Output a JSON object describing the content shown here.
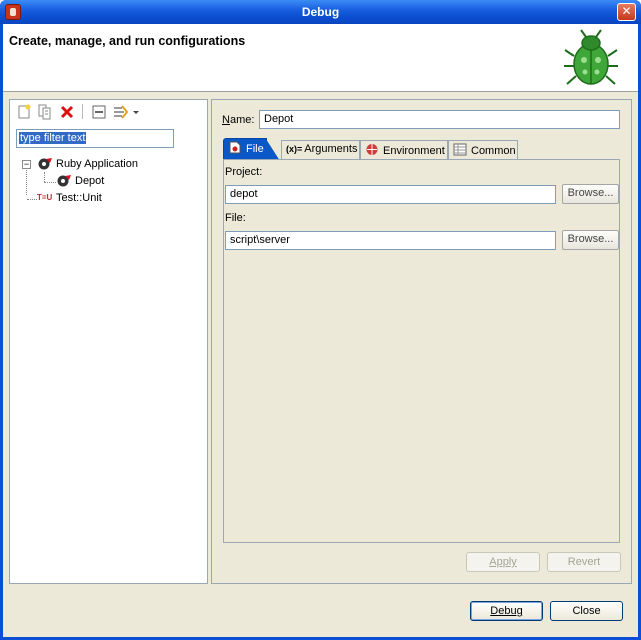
{
  "window": {
    "title": "Debug"
  },
  "banner": {
    "title": "Create, manage, and run configurations",
    "icon": "bug-icon"
  },
  "left_panel": {
    "toolbar": [
      {
        "name": "new-launch-config-icon"
      },
      {
        "name": "duplicate-config-icon"
      },
      {
        "name": "delete-config-icon"
      },
      {
        "name": "collapse-all-icon"
      },
      {
        "name": "filter-configs-icon"
      },
      {
        "name": "view-menu-dropdown-icon"
      }
    ],
    "filter": {
      "value": "type filter text"
    },
    "tree": {
      "expander": "−",
      "items": [
        {
          "label": "Ruby Application",
          "icon": "ruby-app-icon"
        },
        {
          "label": "Depot",
          "icon": "ruby-config-icon"
        },
        {
          "label": "Test::Unit",
          "icon": "testunit-icon",
          "icon_text": "T=U"
        }
      ]
    }
  },
  "right_panel": {
    "name_label_underline": "N",
    "name_label_rest": "ame:",
    "name_value": "Depot",
    "tabs": [
      {
        "label": "File",
        "icon": "file-tab-icon",
        "active": true
      },
      {
        "label": "Arguments",
        "icon": "arguments-tab-icon",
        "icon_text": "(x)="
      },
      {
        "label": "Environment",
        "icon": "environment-tab-icon"
      },
      {
        "label": "Common",
        "icon": "common-tab-icon"
      }
    ],
    "project": {
      "label": "Project:",
      "value": "depot",
      "browse": "Browse..."
    },
    "file": {
      "label": "File:",
      "value": "script\\server",
      "browse": "Browse..."
    },
    "apply": "Apply",
    "revert": "Revert"
  },
  "footer": {
    "debug": "Debug",
    "close": "Close"
  },
  "colors": {
    "titlebar": "#0b4ed2",
    "accent_tab": "#0a57c8",
    "background": "#ece9d8"
  }
}
